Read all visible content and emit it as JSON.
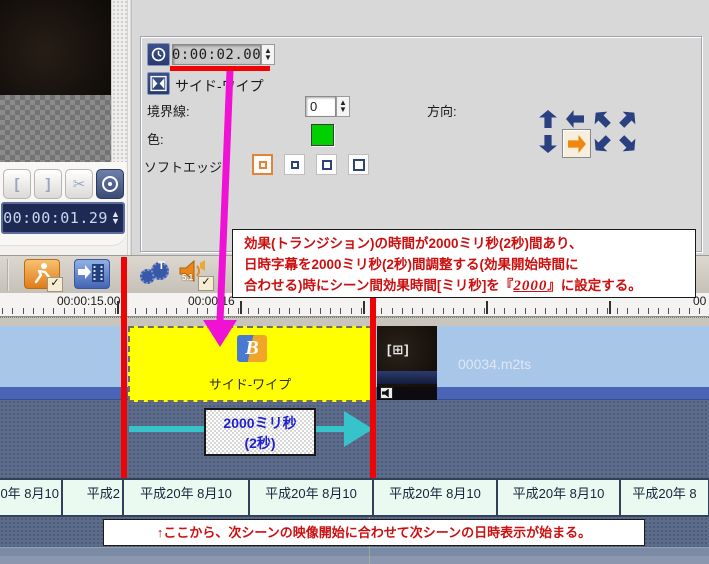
{
  "left_panel": {
    "timecode": "00:00:01.29",
    "trim": {
      "mark_in": "[",
      "mark_out": "]",
      "cut": "✂"
    }
  },
  "properties": {
    "duration": "0:00:02.00",
    "transition_name": "サイド-ワイプ",
    "border_label": "境界線:",
    "border_value": "0",
    "color_label": "色:",
    "softedge_label": "ソフトエッジ:",
    "direction_label": "方向:"
  },
  "toolbar": {
    "effects_t": "T",
    "audio_51": "5.1"
  },
  "ruler": {
    "t15": "00:00:15.00",
    "t16": "00:00:16",
    "t_right": "00"
  },
  "timeline": {
    "transition_clip": "サイド-ワイプ",
    "transition_logo_letter": "B",
    "film_badge": "[⊞]",
    "video_clip": "00034.m2ts",
    "date_cells": [
      "0年 8月10",
      "平成2",
      "平成20年 8月10",
      "平成20年 8月10",
      "平成20年 8月10",
      "平成20年 8月10",
      "平成20年 8"
    ]
  },
  "callouts": {
    "top_line1": "効果(トランジション)の時間が2000ミリ秒(2秒)間あり、",
    "top_line2": "日時字幕を2000ミリ秒(2秒)間調整する(効果開始時間に",
    "top_line3_prefix": "合わせる)時にシーン間効果時間[ミリ秒]を『",
    "top_line3_em": "2000",
    "top_line3_suffix": "』に設定する。",
    "duration_line1": "2000ミリ秒",
    "duration_line2": "(2秒)",
    "bottom": "↑ここから、次シーンの映像開始に合わせて次シーンの日時表示が始まる。"
  },
  "glyphs": {
    "up": "▲",
    "down": "▼",
    "check": "✓"
  },
  "colors": {
    "accent_red": "#ee0404",
    "magenta_arrow": "#f012d4",
    "cyan_arrow": "#36c3ca",
    "selection_yellow": "#ffff00",
    "swatch_green": "#00cf00",
    "direction_selected_orange": "#f08612"
  }
}
